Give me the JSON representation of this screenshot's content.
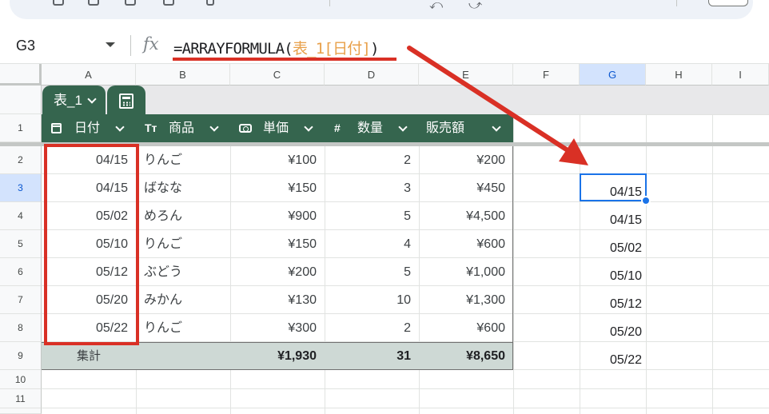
{
  "name_box": {
    "cell_ref": "G3"
  },
  "formula": {
    "prefix": "=ARRAYFORMULA(",
    "ref": "表_1[日付]",
    "suffix": ")"
  },
  "columns": [
    "A",
    "B",
    "C",
    "D",
    "E",
    "F",
    "G",
    "H",
    "I"
  ],
  "selected_column": "G",
  "rows": [
    "1",
    "2",
    "3",
    "4",
    "5",
    "6",
    "7",
    "8",
    "9",
    "10",
    "11"
  ],
  "selected_row": "3",
  "table": {
    "name": "表_1",
    "headers": {
      "date": "日付",
      "product": "商品",
      "price": "単価",
      "qty": "数量",
      "sales": "販売額"
    },
    "header_type_icons": {
      "product": "Tт",
      "qty": "#"
    },
    "rows": [
      {
        "date": "04/15",
        "product": "りんご",
        "price": "¥100",
        "qty": "2",
        "sales": "¥200"
      },
      {
        "date": "04/15",
        "product": "ばなな",
        "price": "¥150",
        "qty": "3",
        "sales": "¥450"
      },
      {
        "date": "05/02",
        "product": "めろん",
        "price": "¥900",
        "qty": "5",
        "sales": "¥4,500"
      },
      {
        "date": "05/10",
        "product": "りんご",
        "price": "¥150",
        "qty": "4",
        "sales": "¥600"
      },
      {
        "date": "05/12",
        "product": "ぶどう",
        "price": "¥200",
        "qty": "5",
        "sales": "¥1,000"
      },
      {
        "date": "05/20",
        "product": "みかん",
        "price": "¥130",
        "qty": "10",
        "sales": "¥1,300"
      },
      {
        "date": "05/22",
        "product": "りんご",
        "price": "¥300",
        "qty": "2",
        "sales": "¥600"
      }
    ],
    "totals": {
      "label": "集計",
      "price": "¥1,930",
      "qty": "31",
      "sales": "¥8,650"
    }
  },
  "column_g_output": [
    "04/15",
    "04/15",
    "05/02",
    "05/10",
    "05/12",
    "05/20",
    "05/22"
  ],
  "colors": {
    "table_header": "#35654e",
    "totals_row": "#ced9d5",
    "highlight_red": "#d93025",
    "selection_blue": "#1a73e8",
    "formula_ref": "#e8a04a"
  }
}
